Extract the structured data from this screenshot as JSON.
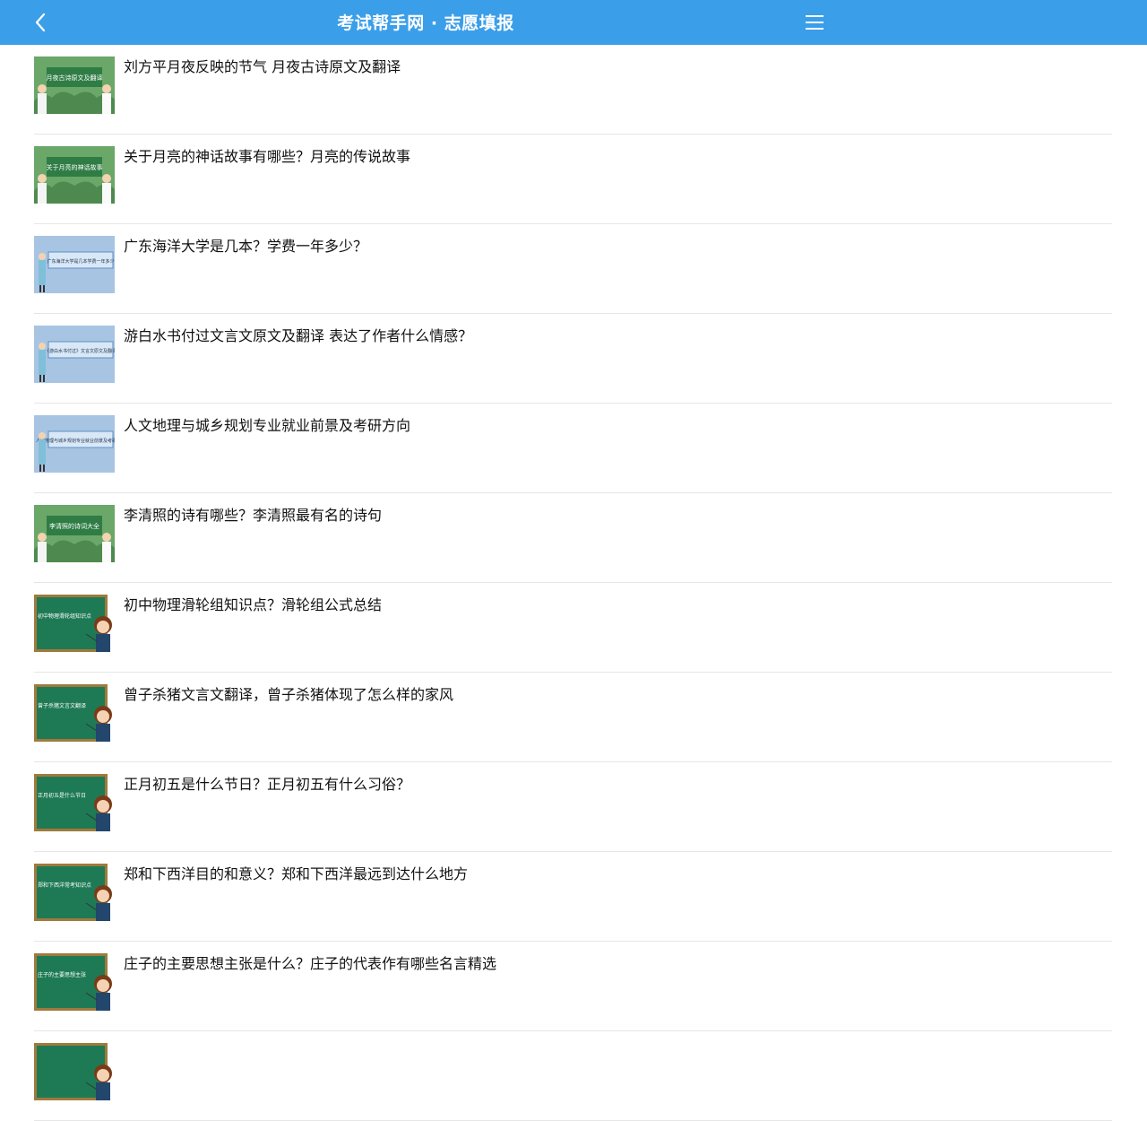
{
  "header": {
    "title": "考试帮手网 · 志愿填报",
    "back_icon": "chevron-left-icon",
    "menu_icon": "hamburger-menu-icon",
    "background": "#3b9ee9"
  },
  "articles": [
    {
      "title": "刘方平月夜反映的节气 月夜古诗原文及翻译",
      "thumb_style": "green-duo",
      "thumb_text": "月夜古诗原文及翻译"
    },
    {
      "title": "关于月亮的神话故事有哪些？月亮的传说故事",
      "thumb_style": "green-duo",
      "thumb_text": "关于月亮的神话故事"
    },
    {
      "title": "广东海洋大学是几本？学费一年多少？",
      "thumb_style": "blue-board",
      "thumb_text": "广东海洋大学是几本学费一年多少"
    },
    {
      "title": "游白水书付过文言文原文及翻译 表达了作者什么情感？",
      "thumb_style": "blue-board",
      "thumb_text": "《游白水书付过》文言文原文及翻译"
    },
    {
      "title": "人文地理与城乡规划专业就业前景及考研方向",
      "thumb_style": "blue-board",
      "thumb_text": "人文地理与城乡规划专业就业前景及考研方向"
    },
    {
      "title": "李清照的诗有哪些？李清照最有名的诗句",
      "thumb_style": "green-duo",
      "thumb_text": "李清照的诗词大全"
    },
    {
      "title": "初中物理滑轮组知识点？滑轮组公式总结",
      "thumb_style": "chalkboard",
      "thumb_text": "初中物理滑轮组知识点"
    },
    {
      "title": "曾子杀猪文言文翻译，曾子杀猪体现了怎么样的家风",
      "thumb_style": "chalkboard",
      "thumb_text": "曾子杀猪文言文翻译"
    },
    {
      "title": "正月初五是什么节日？正月初五有什么习俗？",
      "thumb_style": "chalkboard",
      "thumb_text": "正月初五是什么节日"
    },
    {
      "title": "郑和下西洋目的和意义？郑和下西洋最远到达什么地方",
      "thumb_style": "chalkboard",
      "thumb_text": "郑和下西洋常考知识点"
    },
    {
      "title": "庄子的主要思想主张是什么？庄子的代表作有哪些名言精选",
      "thumb_style": "chalkboard",
      "thumb_text": "庄子的主要思想主张"
    },
    {
      "title": "",
      "thumb_style": "chalkboard",
      "thumb_text": ""
    }
  ]
}
